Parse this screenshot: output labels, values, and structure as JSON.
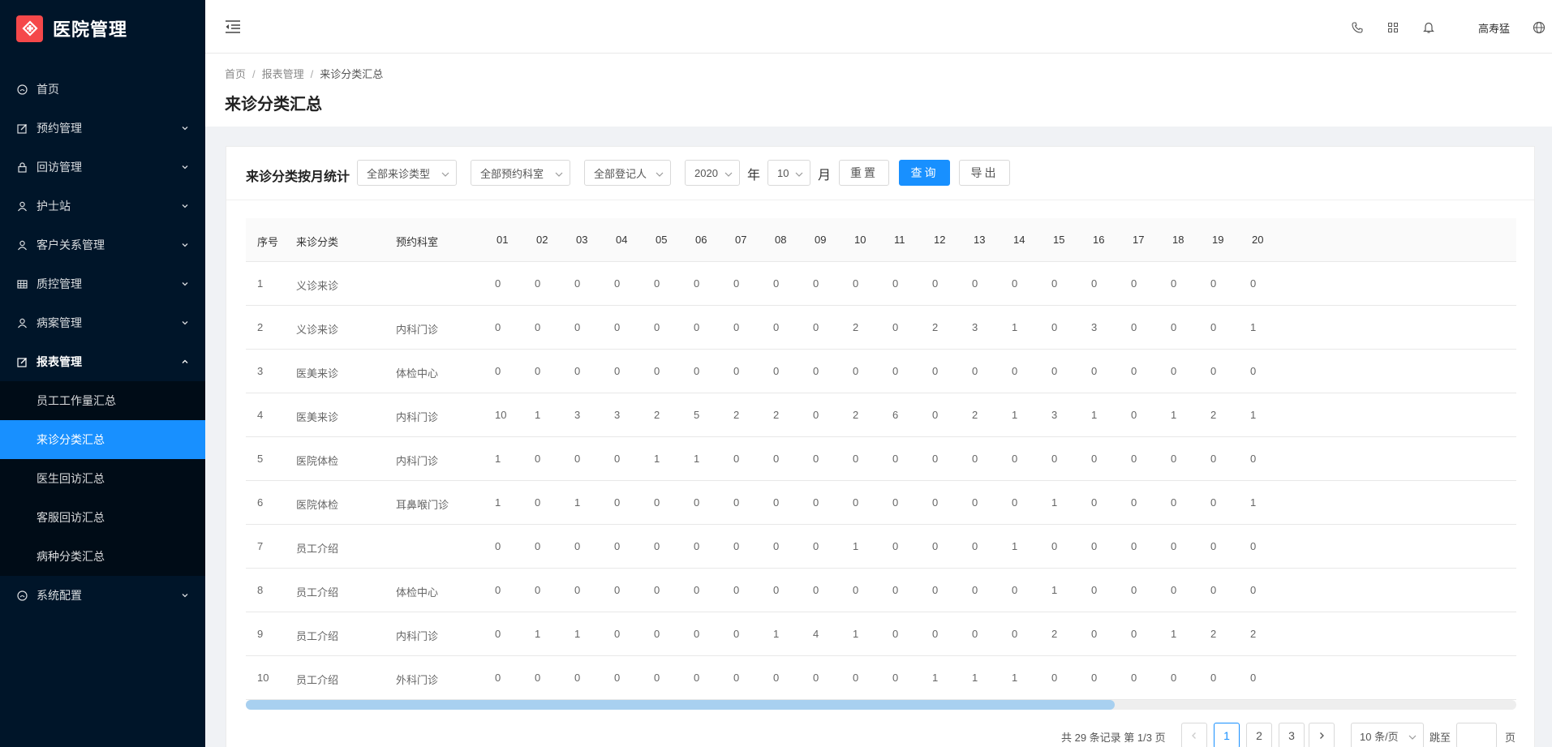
{
  "app": {
    "title": "医院管理"
  },
  "sidebar": {
    "items": [
      {
        "label": "首页",
        "icon": "dashboard-icon",
        "has_arrow": false
      },
      {
        "label": "预约管理",
        "icon": "edit-icon",
        "has_arrow": true
      },
      {
        "label": "回访管理",
        "icon": "lock-icon",
        "has_arrow": true
      },
      {
        "label": "护士站",
        "icon": "user-icon",
        "has_arrow": true
      },
      {
        "label": "客户关系管理",
        "icon": "user-icon",
        "has_arrow": true
      },
      {
        "label": "质控管理",
        "icon": "table-icon",
        "has_arrow": true
      },
      {
        "label": "病案管理",
        "icon": "user-icon",
        "has_arrow": true
      },
      {
        "label": "报表管理",
        "icon": "edit-icon",
        "has_arrow": true,
        "expanded": true
      }
    ],
    "submenu": [
      {
        "label": "员工工作量汇总"
      },
      {
        "label": "来诊分类汇总",
        "selected": true
      },
      {
        "label": "医生回访汇总"
      },
      {
        "label": "客服回访汇总"
      },
      {
        "label": "病种分类汇总"
      }
    ],
    "after": [
      {
        "label": "系统配置",
        "icon": "dashboard-icon",
        "has_arrow": true
      }
    ]
  },
  "header": {
    "user_name": "高寿猛",
    "icons": [
      "phone-icon",
      "apps-icon",
      "bell-icon",
      "globe-icon"
    ]
  },
  "breadcrumb": [
    "首页",
    "报表管理",
    "来诊分类汇总"
  ],
  "page_title": "来诊分类汇总",
  "toolbar": {
    "title": "来诊分类按月统计",
    "visit_type_select": "全部来诊类型",
    "dept_select": "全部预约科室",
    "registrar_select": "全部登记人",
    "year_select": "2020",
    "year_label": "年",
    "month_select": "10",
    "month_label": "月",
    "reset_label": "重置",
    "query_label": "查询",
    "export_label": "导出"
  },
  "table": {
    "columns": [
      "序号",
      "来诊分类",
      "预约科室",
      "01",
      "02",
      "03",
      "04",
      "05",
      "06",
      "07",
      "08",
      "09",
      "10",
      "11",
      "12",
      "13",
      "14",
      "15",
      "16",
      "17",
      "18",
      "19",
      "20"
    ],
    "rows": [
      [
        "1",
        "义诊来诊",
        "",
        "0",
        "0",
        "0",
        "0",
        "0",
        "0",
        "0",
        "0",
        "0",
        "0",
        "0",
        "0",
        "0",
        "0",
        "0",
        "0",
        "0",
        "0",
        "0",
        "0"
      ],
      [
        "2",
        "义诊来诊",
        "内科门诊",
        "0",
        "0",
        "0",
        "0",
        "0",
        "0",
        "0",
        "0",
        "0",
        "2",
        "0",
        "2",
        "3",
        "1",
        "0",
        "3",
        "0",
        "0",
        "0",
        "1"
      ],
      [
        "3",
        "医美来诊",
        "体检中心",
        "0",
        "0",
        "0",
        "0",
        "0",
        "0",
        "0",
        "0",
        "0",
        "0",
        "0",
        "0",
        "0",
        "0",
        "0",
        "0",
        "0",
        "0",
        "0",
        "0"
      ],
      [
        "4",
        "医美来诊",
        "内科门诊",
        "10",
        "1",
        "3",
        "3",
        "2",
        "5",
        "2",
        "2",
        "0",
        "2",
        "6",
        "0",
        "2",
        "1",
        "3",
        "1",
        "0",
        "1",
        "2",
        "1"
      ],
      [
        "5",
        "医院体检",
        "内科门诊",
        "1",
        "0",
        "0",
        "0",
        "1",
        "1",
        "0",
        "0",
        "0",
        "0",
        "0",
        "0",
        "0",
        "0",
        "0",
        "0",
        "0",
        "0",
        "0",
        "0"
      ],
      [
        "6",
        "医院体检",
        "耳鼻喉门诊",
        "1",
        "0",
        "1",
        "0",
        "0",
        "0",
        "0",
        "0",
        "0",
        "0",
        "0",
        "0",
        "0",
        "0",
        "1",
        "0",
        "0",
        "0",
        "0",
        "1"
      ],
      [
        "7",
        "员工介绍",
        "",
        "0",
        "0",
        "0",
        "0",
        "0",
        "0",
        "0",
        "0",
        "0",
        "1",
        "0",
        "0",
        "0",
        "1",
        "0",
        "0",
        "0",
        "0",
        "0",
        "0"
      ],
      [
        "8",
        "员工介绍",
        "体检中心",
        "0",
        "0",
        "0",
        "0",
        "0",
        "0",
        "0",
        "0",
        "0",
        "0",
        "0",
        "0",
        "0",
        "0",
        "1",
        "0",
        "0",
        "0",
        "0",
        "0"
      ],
      [
        "9",
        "员工介绍",
        "内科门诊",
        "0",
        "1",
        "1",
        "0",
        "0",
        "0",
        "0",
        "1",
        "4",
        "1",
        "0",
        "0",
        "0",
        "0",
        "2",
        "0",
        "0",
        "1",
        "2",
        "2"
      ],
      [
        "10",
        "员工介绍",
        "外科门诊",
        "0",
        "0",
        "0",
        "0",
        "0",
        "0",
        "0",
        "0",
        "0",
        "0",
        "0",
        "1",
        "1",
        "1",
        "0",
        "0",
        "0",
        "0",
        "0",
        "0"
      ]
    ]
  },
  "pagination": {
    "total_text": "共 29 条记录 第 1/3 页",
    "pages": [
      "1",
      "2",
      "3"
    ],
    "current": "1",
    "page_size": "10 条/页",
    "jump_label": "跳至",
    "jump_suffix": "页"
  },
  "colors": {
    "sidebar_bg": "#001529",
    "accent": "#1890ff",
    "logo": "#f5484a"
  }
}
